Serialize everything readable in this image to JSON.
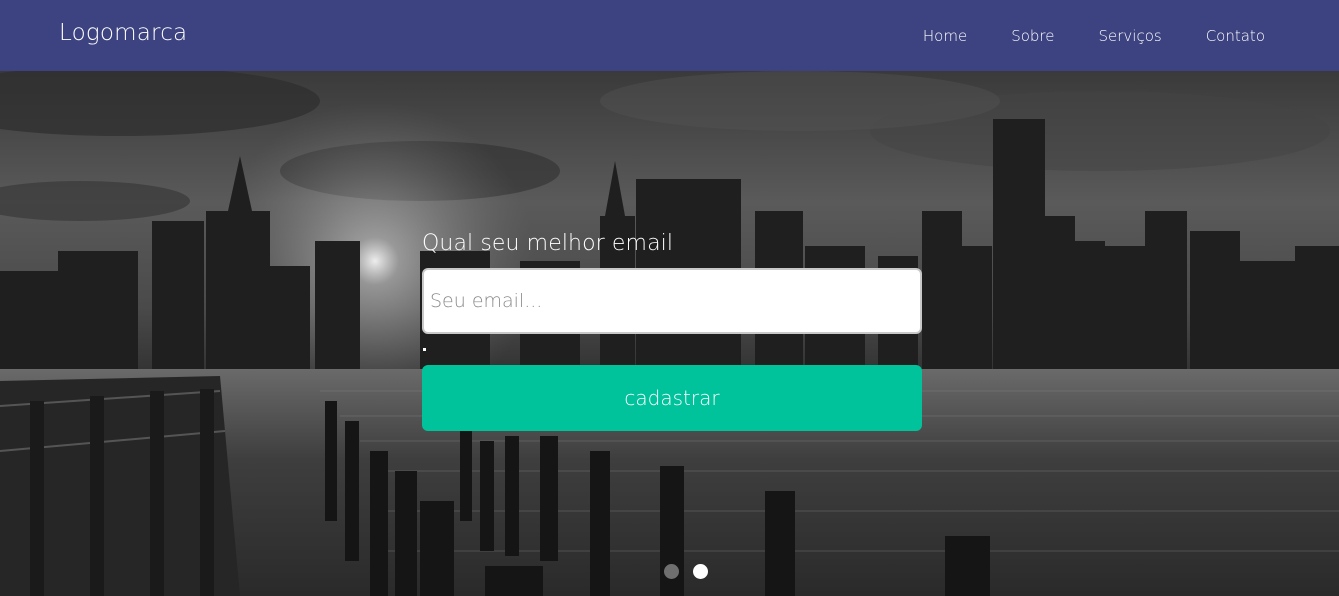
{
  "navbar": {
    "logo": "Logomarca",
    "links": [
      "Home",
      "Sobre",
      "Serviços",
      "Contato"
    ],
    "background": "#3d4380"
  },
  "hero": {
    "form": {
      "label": "Qual seu melhor email",
      "email_placeholder": "Seu email...",
      "submit_label": "cadastrar"
    },
    "carousel": {
      "slides": 2,
      "active_index": 1
    },
    "accent": "#00c29b"
  }
}
